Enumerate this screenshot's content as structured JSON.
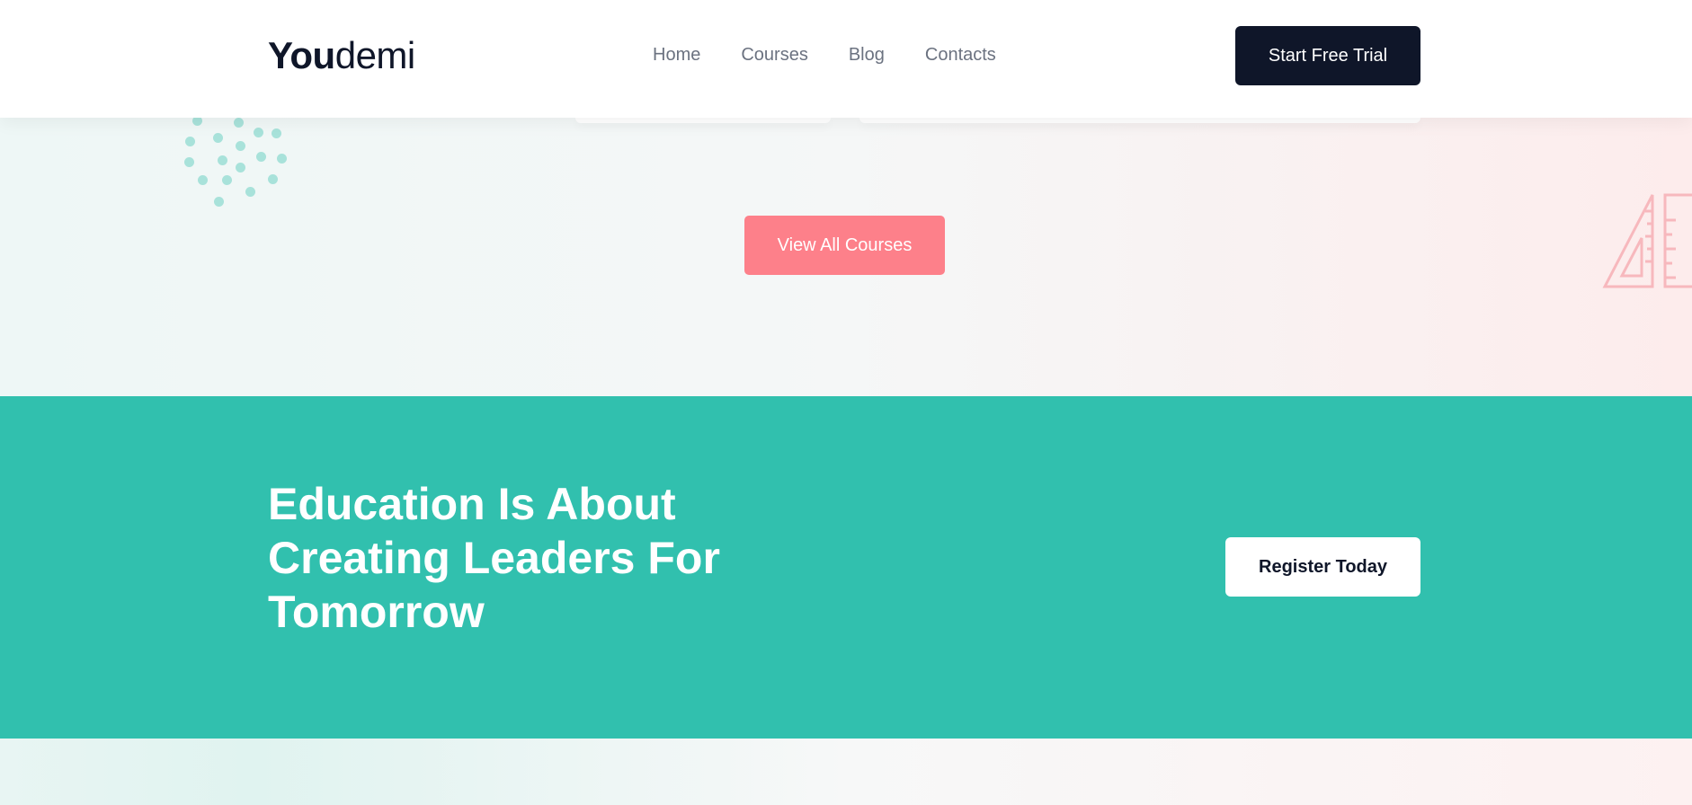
{
  "header": {
    "logo": {
      "bold": "You",
      "light": "demi"
    },
    "nav": [
      "Home",
      "Courses",
      "Blog",
      "Contacts"
    ],
    "cta_label": "Start Free Trial"
  },
  "courses_section": {
    "view_all_label": "View All Courses",
    "decorations": [
      "dots-pattern",
      "ruler-icon"
    ]
  },
  "cta_banner": {
    "heading": "Education Is About Creating Leaders For Tomorrow",
    "button_label": "Register Today"
  },
  "colors": {
    "dark": "#0f1629",
    "teal": "#31c0ae",
    "coral": "#fd808a",
    "nav_text": "#6b7280",
    "dots": "#a8e2da"
  }
}
